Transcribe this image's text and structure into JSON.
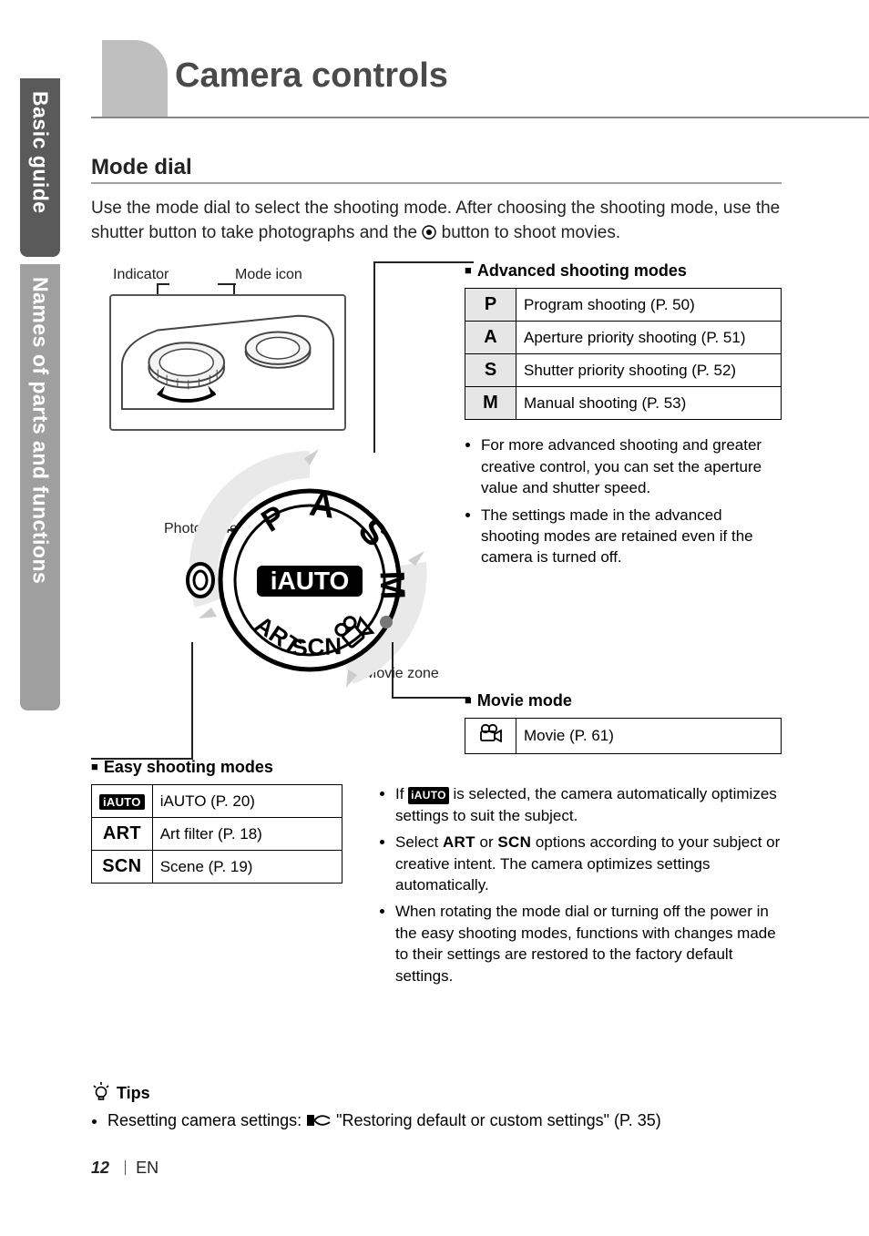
{
  "sidebar": {
    "tab1": "Basic guide",
    "tab2": "Names of parts and functions"
  },
  "chapter_title": "Camera controls",
  "section_title": "Mode dial",
  "intro_a": "Use the mode dial to select the shooting mode. After choosing the shooting mode, use the shutter button to take photographs and the ",
  "intro_b": " button to shoot movies.",
  "labels": {
    "indicator": "Indicator",
    "mode_icon": "Mode icon",
    "photo_zone": "Photo zone",
    "movie_zone": "Movie zone"
  },
  "advanced": {
    "heading": "Advanced shooting modes",
    "rows": [
      {
        "sym": "P",
        "desc": "Program shooting (P. 50)"
      },
      {
        "sym": "A",
        "desc": "Aperture priority shooting (P. 51)"
      },
      {
        "sym": "S",
        "desc": "Shutter priority shooting (P. 52)"
      },
      {
        "sym": "M",
        "desc": "Manual shooting (P. 53)"
      }
    ],
    "bullets": [
      "For more advanced shooting and greater creative control, you can set the aperture value and shutter speed.",
      "The settings made in the advanced shooting modes are retained even if the camera is turned off."
    ]
  },
  "movie": {
    "heading": "Movie mode",
    "desc": "Movie (P. 61)"
  },
  "easy": {
    "heading": "Easy shooting modes",
    "rows": [
      {
        "sym_type": "iauto",
        "sym": "iAUTO",
        "desc": "iAUTO (P. 20)"
      },
      {
        "sym_type": "art",
        "sym": "ART",
        "desc": "Art filter (P. 18)"
      },
      {
        "sym_type": "scn",
        "sym": "SCN",
        "desc": "Scene (P. 19)"
      }
    ],
    "bullets_pre": "If ",
    "bullets_post": " is selected, the camera automatically optimizes settings to suit the subject.",
    "bullet2_a": "Select ",
    "bullet2_art": "ART",
    "bullet2_mid": " or ",
    "bullet2_scn": "SCN",
    "bullet2_b": " options according to your subject or creative intent. The camera optimizes settings automatically.",
    "bullet3": "When rotating the mode dial or turning off the power in the easy shooting modes, functions with changes made to their settings are restored to the factory default settings."
  },
  "tips": {
    "heading": "Tips",
    "item_a": "Resetting camera settings: ",
    "item_b": "  \"Restoring default or custom settings\" (P. 35)"
  },
  "footer": {
    "page": "12",
    "lang": "EN"
  }
}
